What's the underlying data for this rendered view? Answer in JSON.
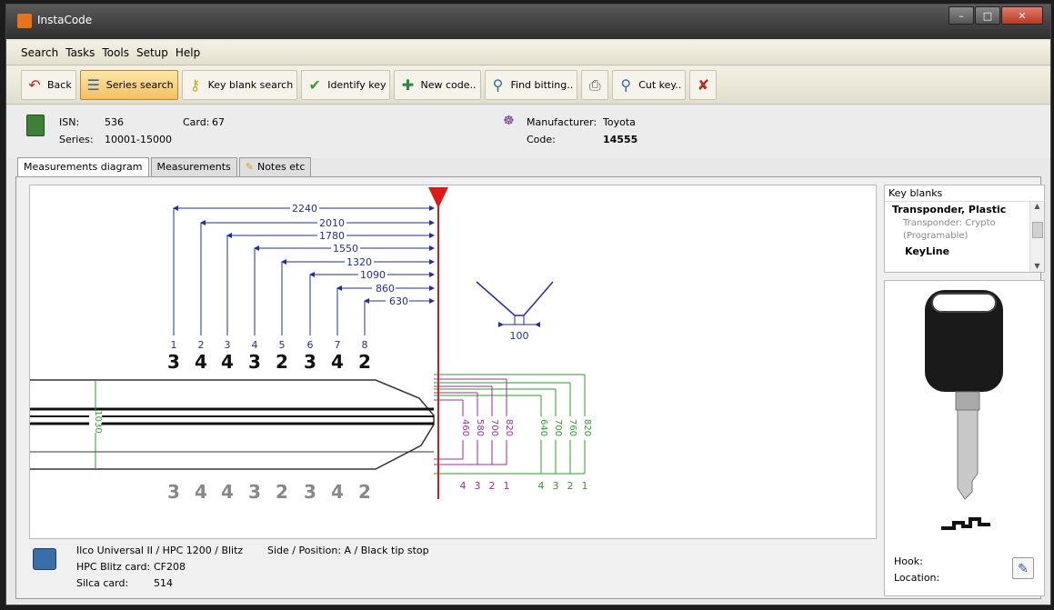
{
  "window": {
    "title": "InstaCode"
  },
  "menu": [
    "Search",
    "Tasks",
    "Tools",
    "Setup",
    "Help"
  ],
  "toolbar": {
    "back": "Back",
    "series_search": "Series search",
    "key_blank_search": "Key blank search",
    "identify_key": "Identify key",
    "new_code": "New code..",
    "find_bitting": "Find bitting..",
    "cut_key": "Cut key.."
  },
  "info": {
    "isn_label": "ISN:",
    "isn_value": "536",
    "card_label": "Card:",
    "card_value": "67",
    "series_label": "Series:",
    "series_value": "10001-15000",
    "manufacturer_label": "Manufacturer:",
    "manufacturer_value": "Toyota",
    "code_label": "Code:",
    "code_value": "14555"
  },
  "tabs": [
    "Measurements diagram",
    "Measurements",
    "Notes etc"
  ],
  "diagram": {
    "distances": [
      "2240",
      "2010",
      "1780",
      "1550",
      "1320",
      "1090",
      "860",
      "630"
    ],
    "positions": [
      "1",
      "2",
      "3",
      "4",
      "5",
      "6",
      "7",
      "8"
    ],
    "bitting": [
      "3",
      "4",
      "4",
      "3",
      "2",
      "3",
      "4",
      "2"
    ],
    "width_label": "100",
    "blade_height": "1030",
    "depths_purple": [
      "460",
      "580",
      "700",
      "820"
    ],
    "depths_green": [
      "640",
      "700",
      "760",
      "820"
    ],
    "depth_labels": [
      "4",
      "3",
      "2",
      "1",
      "4",
      "3",
      "2",
      "1"
    ]
  },
  "bottom": {
    "machine": "Ilco Universal II / HPC 1200 / Blitz",
    "side_position": "Side / Position: A / Black tip stop",
    "hpc_label": "HPC Blitz card:",
    "hpc_value": "CF208",
    "silca_label": "Silca card:",
    "silca_value": "514"
  },
  "key_blanks": {
    "header": "Key blanks",
    "group": "Transponder, Plastic",
    "sub1": "Transponder: Crypto",
    "sub2": "(Programable)",
    "brand": "KeyLine"
  },
  "key_panel": {
    "hook_label": "Hook:",
    "location_label": "Location:"
  }
}
